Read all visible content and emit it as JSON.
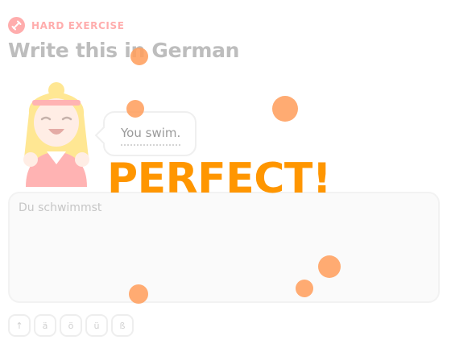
{
  "header": {
    "tag_icon": "dumbbell-icon",
    "tag_label": "HARD EXERCISE",
    "title": "Write this in German"
  },
  "prompt": {
    "text": "You swim."
  },
  "answer": {
    "value": "Du schwimmst"
  },
  "special_characters": [
    {
      "label": "↑",
      "icon": "shift-up-arrow-icon"
    },
    {
      "label": "ä"
    },
    {
      "label": "ö"
    },
    {
      "label": "ü"
    },
    {
      "label": "ß"
    }
  ],
  "celebration": {
    "text": "PERFECT!"
  },
  "colors": {
    "accent_red": "#ff4b4b",
    "celebration_orange": "#ff9600",
    "confetti": "#ff9f5e"
  }
}
